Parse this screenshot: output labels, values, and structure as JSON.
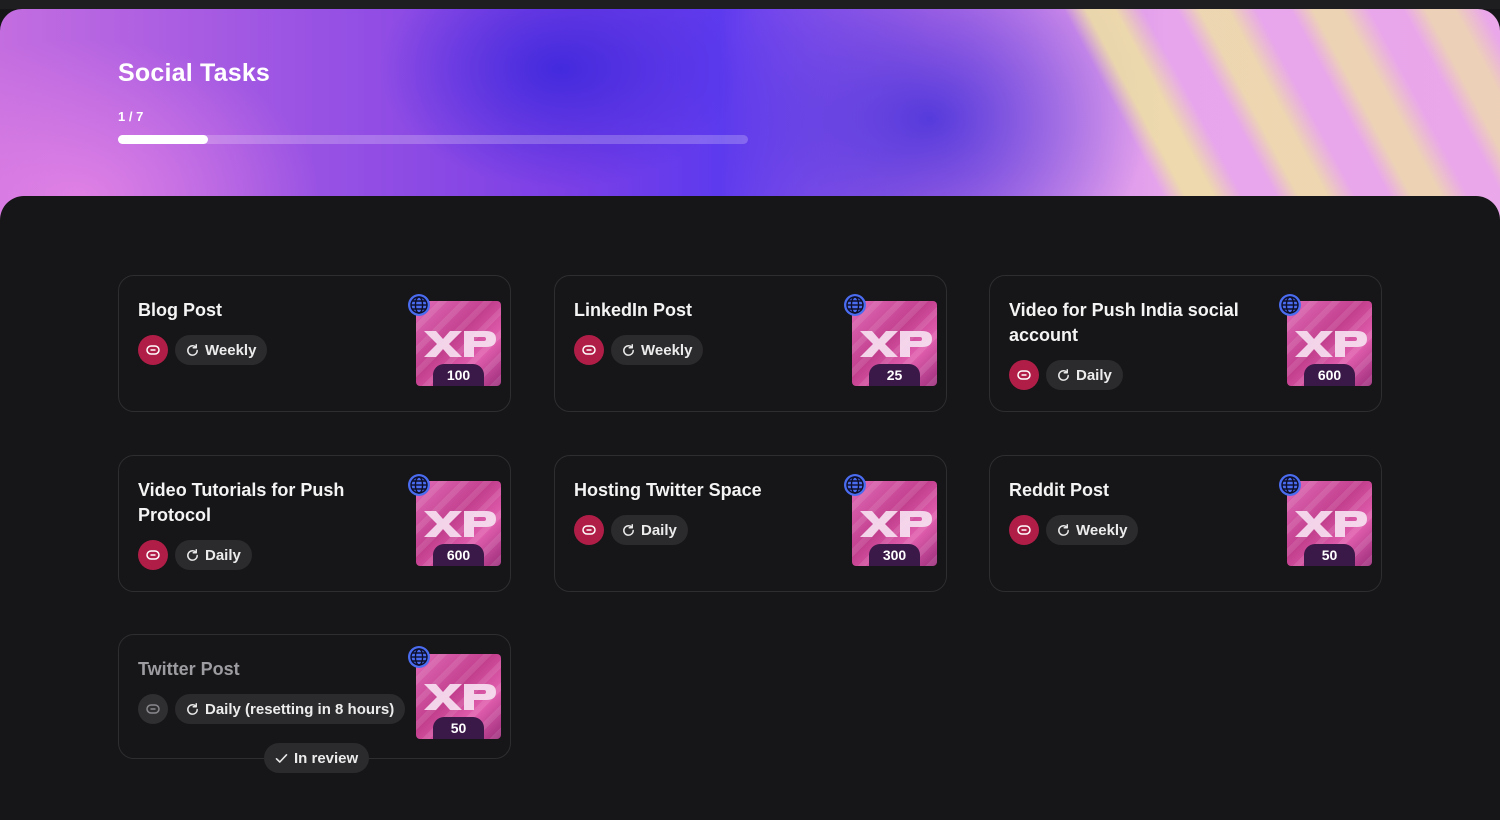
{
  "header": {
    "title": "Social Tasks",
    "progress_text": "1 / 7",
    "progress_value": 0.143
  },
  "tasks": [
    {
      "title": "Blog Post",
      "frequency": "Weekly",
      "xp": "100",
      "status": ""
    },
    {
      "title": "LinkedIn Post",
      "frequency": "Weekly",
      "xp": "25",
      "status": ""
    },
    {
      "title": "Video for Push India social account",
      "frequency": "Daily",
      "xp": "600",
      "status": ""
    },
    {
      "title": "Video Tutorials for Push Protocol",
      "frequency": "Daily",
      "xp": "600",
      "status": ""
    },
    {
      "title": "Hosting Twitter Space",
      "frequency": "Daily",
      "xp": "300",
      "status": ""
    },
    {
      "title": "Reddit Post",
      "frequency": "Weekly",
      "xp": "50",
      "status": ""
    },
    {
      "title": "Twitter Post",
      "frequency": "Daily (resetting in 8 hours)",
      "xp": "50",
      "status": "In review"
    }
  ],
  "colors": {
    "link_button": "#b01e48",
    "link_button_disabled": "#2f2e31",
    "globe": "#4a6cf0",
    "xp_badge": "#3a1948",
    "background": "#161517"
  },
  "icons": {
    "link": "link-icon",
    "frequency": "refresh-icon",
    "network": "globe-icon",
    "status": "checkmark-icon"
  }
}
